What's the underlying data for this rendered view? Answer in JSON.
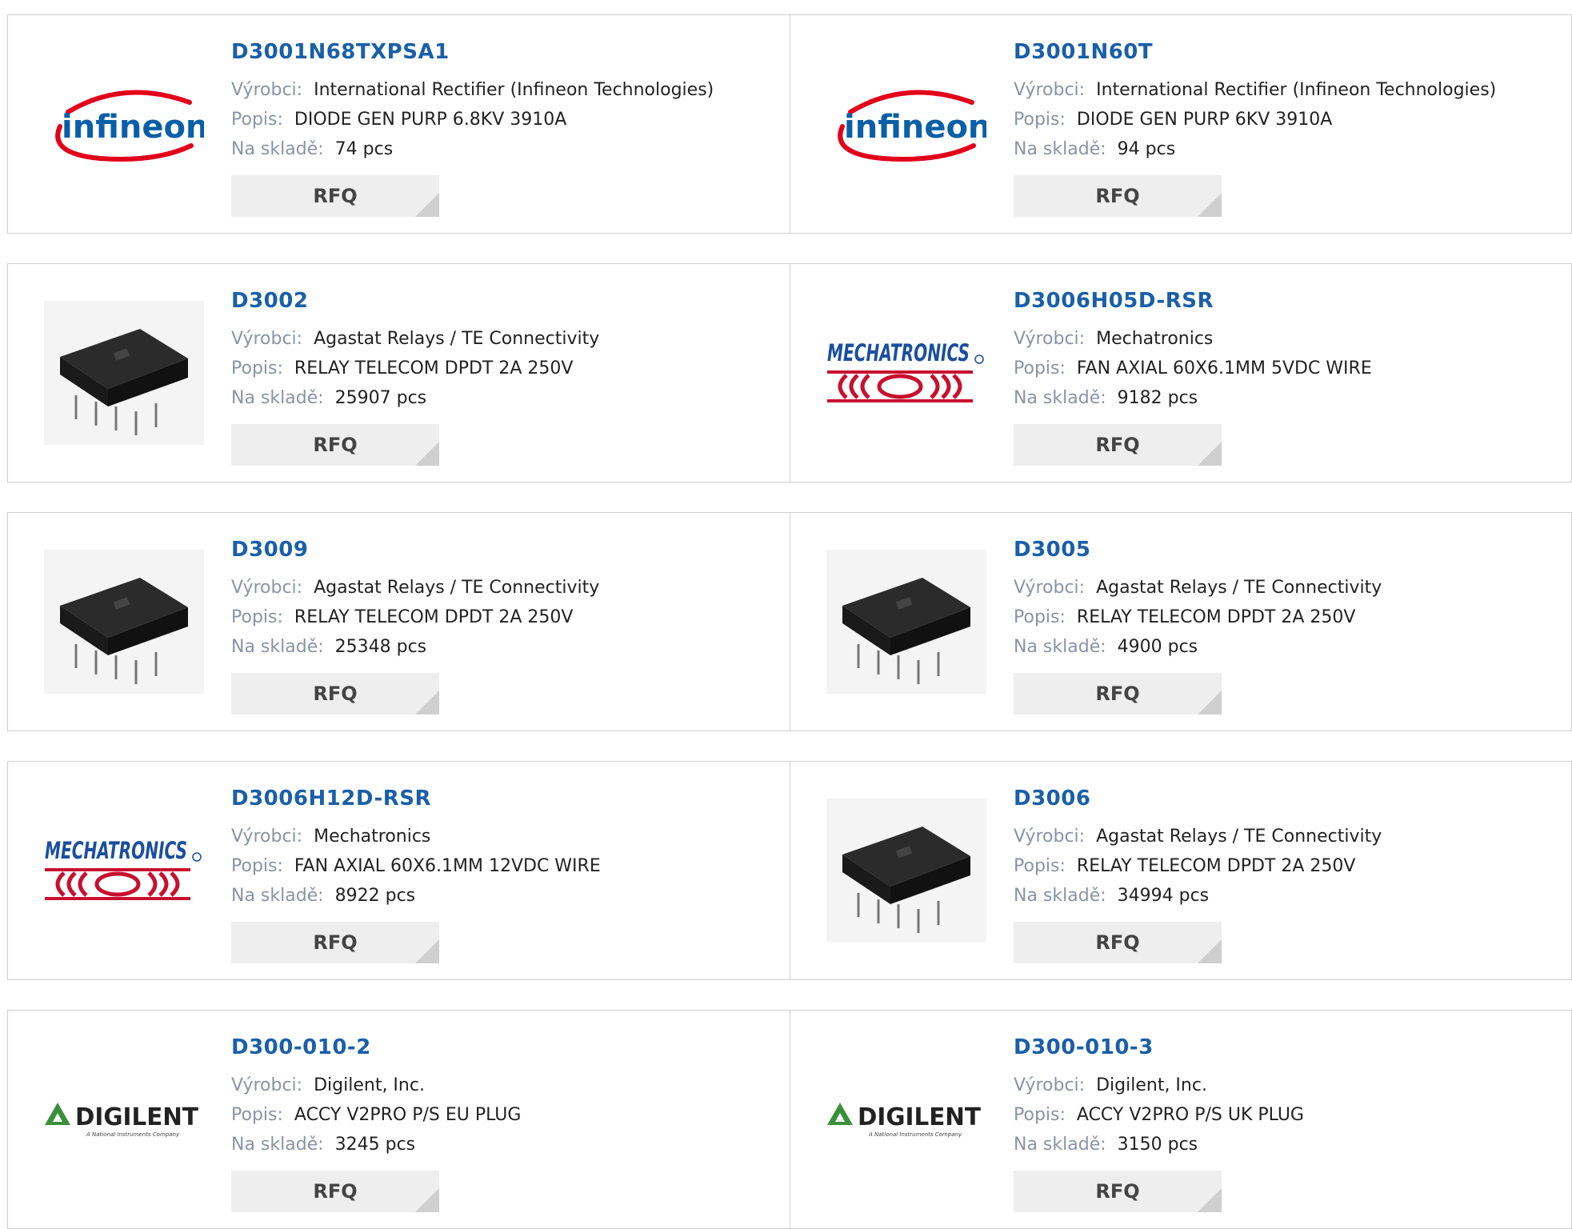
{
  "labels": {
    "manufacturer": "Výrobci:",
    "description": "Popis:",
    "stock": "Na skladě:",
    "rfq": "RFQ"
  },
  "products": [
    {
      "part": "D3001N68TXPSA1",
      "manufacturer": "International Rectifier (Infineon Technologies)",
      "description": "DIODE GEN PURP 6.8KV 3910A",
      "stock": "74 pcs",
      "logo": "infineon-logo",
      "logo_text": "infineon"
    },
    {
      "part": "D3001N60T",
      "manufacturer": "International Rectifier (Infineon Technologies)",
      "description": "DIODE GEN PURP 6KV 3910A",
      "stock": "94 pcs",
      "logo": "infineon-logo",
      "logo_text": "infineon"
    },
    {
      "part": "D3002",
      "manufacturer": "Agastat Relays / TE Connectivity",
      "description": "RELAY TELECOM DPDT 2A 250V",
      "stock": "25907 pcs",
      "logo": "relay-image"
    },
    {
      "part": "D3006H05D-RSR",
      "manufacturer": "Mechatronics",
      "description": "FAN AXIAL 60X6.1MM 5VDC WIRE",
      "stock": "9182 pcs",
      "logo": "mechatronics-logo",
      "logo_text": "MECHATRONICS"
    },
    {
      "part": "D3009",
      "manufacturer": "Agastat Relays / TE Connectivity",
      "description": "RELAY TELECOM DPDT 2A 250V",
      "stock": "25348 pcs",
      "logo": "relay-image"
    },
    {
      "part": "D3005",
      "manufacturer": "Agastat Relays / TE Connectivity",
      "description": "RELAY TELECOM DPDT 2A 250V",
      "stock": "4900 pcs",
      "logo": "relay-image"
    },
    {
      "part": "D3006H12D-RSR",
      "manufacturer": "Mechatronics",
      "description": "FAN AXIAL 60X6.1MM 12VDC WIRE",
      "stock": "8922 pcs",
      "logo": "mechatronics-logo",
      "logo_text": "MECHATRONICS"
    },
    {
      "part": "D3006",
      "manufacturer": "Agastat Relays / TE Connectivity",
      "description": "RELAY TELECOM DPDT 2A 250V",
      "stock": "34994 pcs",
      "logo": "relay-image"
    },
    {
      "part": "D300-010-2",
      "manufacturer": "Digilent, Inc.",
      "description": "ACCY V2PRO P/S EU PLUG",
      "stock": "3245 pcs",
      "logo": "digilent-logo",
      "logo_text": "DIGILENT",
      "logo_subtext": "A National Instruments Company"
    },
    {
      "part": "D300-010-3",
      "manufacturer": "Digilent, Inc.",
      "description": "ACCY V2PRO P/S UK PLUG",
      "stock": "3150 pcs",
      "logo": "digilent-logo",
      "logo_text": "DIGILENT",
      "logo_subtext": "A National Instruments Company"
    }
  ],
  "colors": {
    "part_link": "#1a5fa8",
    "label": "#8a93a5",
    "border": "#cfcfcf",
    "rfq_bg": "#eeeeee",
    "infineon_red": "#e2001a",
    "infineon_blue": "#0a5fa8",
    "mechatronics_blue": "#1a4ea0",
    "mechatronics_red": "#c8102e",
    "digilent_green": "#3b8f3b"
  }
}
